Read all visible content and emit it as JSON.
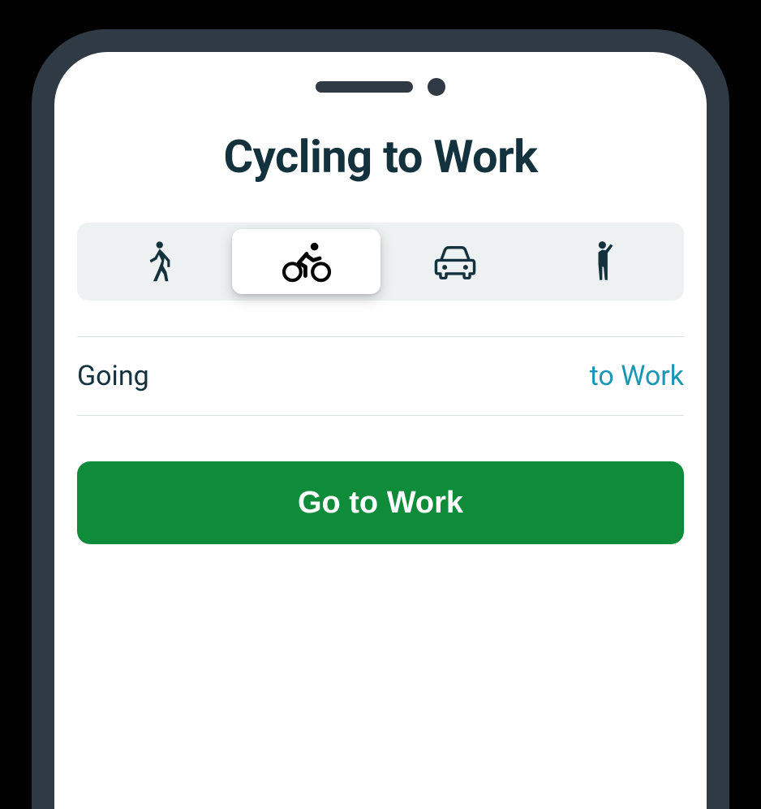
{
  "title": "Cycling to Work",
  "tabs": [
    {
      "name": "walking-icon",
      "active": false
    },
    {
      "name": "cycling-icon",
      "active": true
    },
    {
      "name": "car-icon",
      "active": false
    },
    {
      "name": "waving-person-icon",
      "active": false
    }
  ],
  "row": {
    "label": "Going",
    "value": "to Work"
  },
  "primary_button": "Go to Work",
  "colors": {
    "accent": "#0f8c3a",
    "link": "#1a97b5",
    "text": "#14323d",
    "tab_bg": "#eef1f2"
  }
}
